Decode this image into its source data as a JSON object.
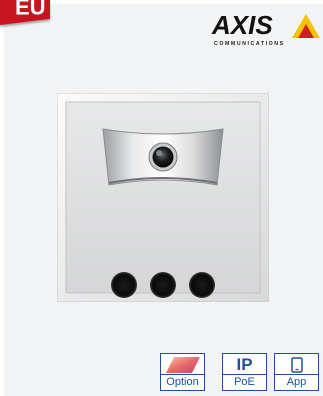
{
  "badge": {
    "text": "EU",
    "color": "#c8141f"
  },
  "brand": {
    "logo_word": "AXIS",
    "logo_sub": "COMMUNICATIONS",
    "triangle_colors": [
      "#f3c400",
      "#d21e1e"
    ]
  },
  "product_image": {
    "icon": "door-station-camera-panel"
  },
  "features": [
    {
      "icon": "pal-icon",
      "label": "Option"
    },
    {
      "top": "IP",
      "label": "PoE"
    },
    {
      "icon": "smartphone-icon",
      "label": "App"
    }
  ],
  "accent": "#1f4f9c"
}
